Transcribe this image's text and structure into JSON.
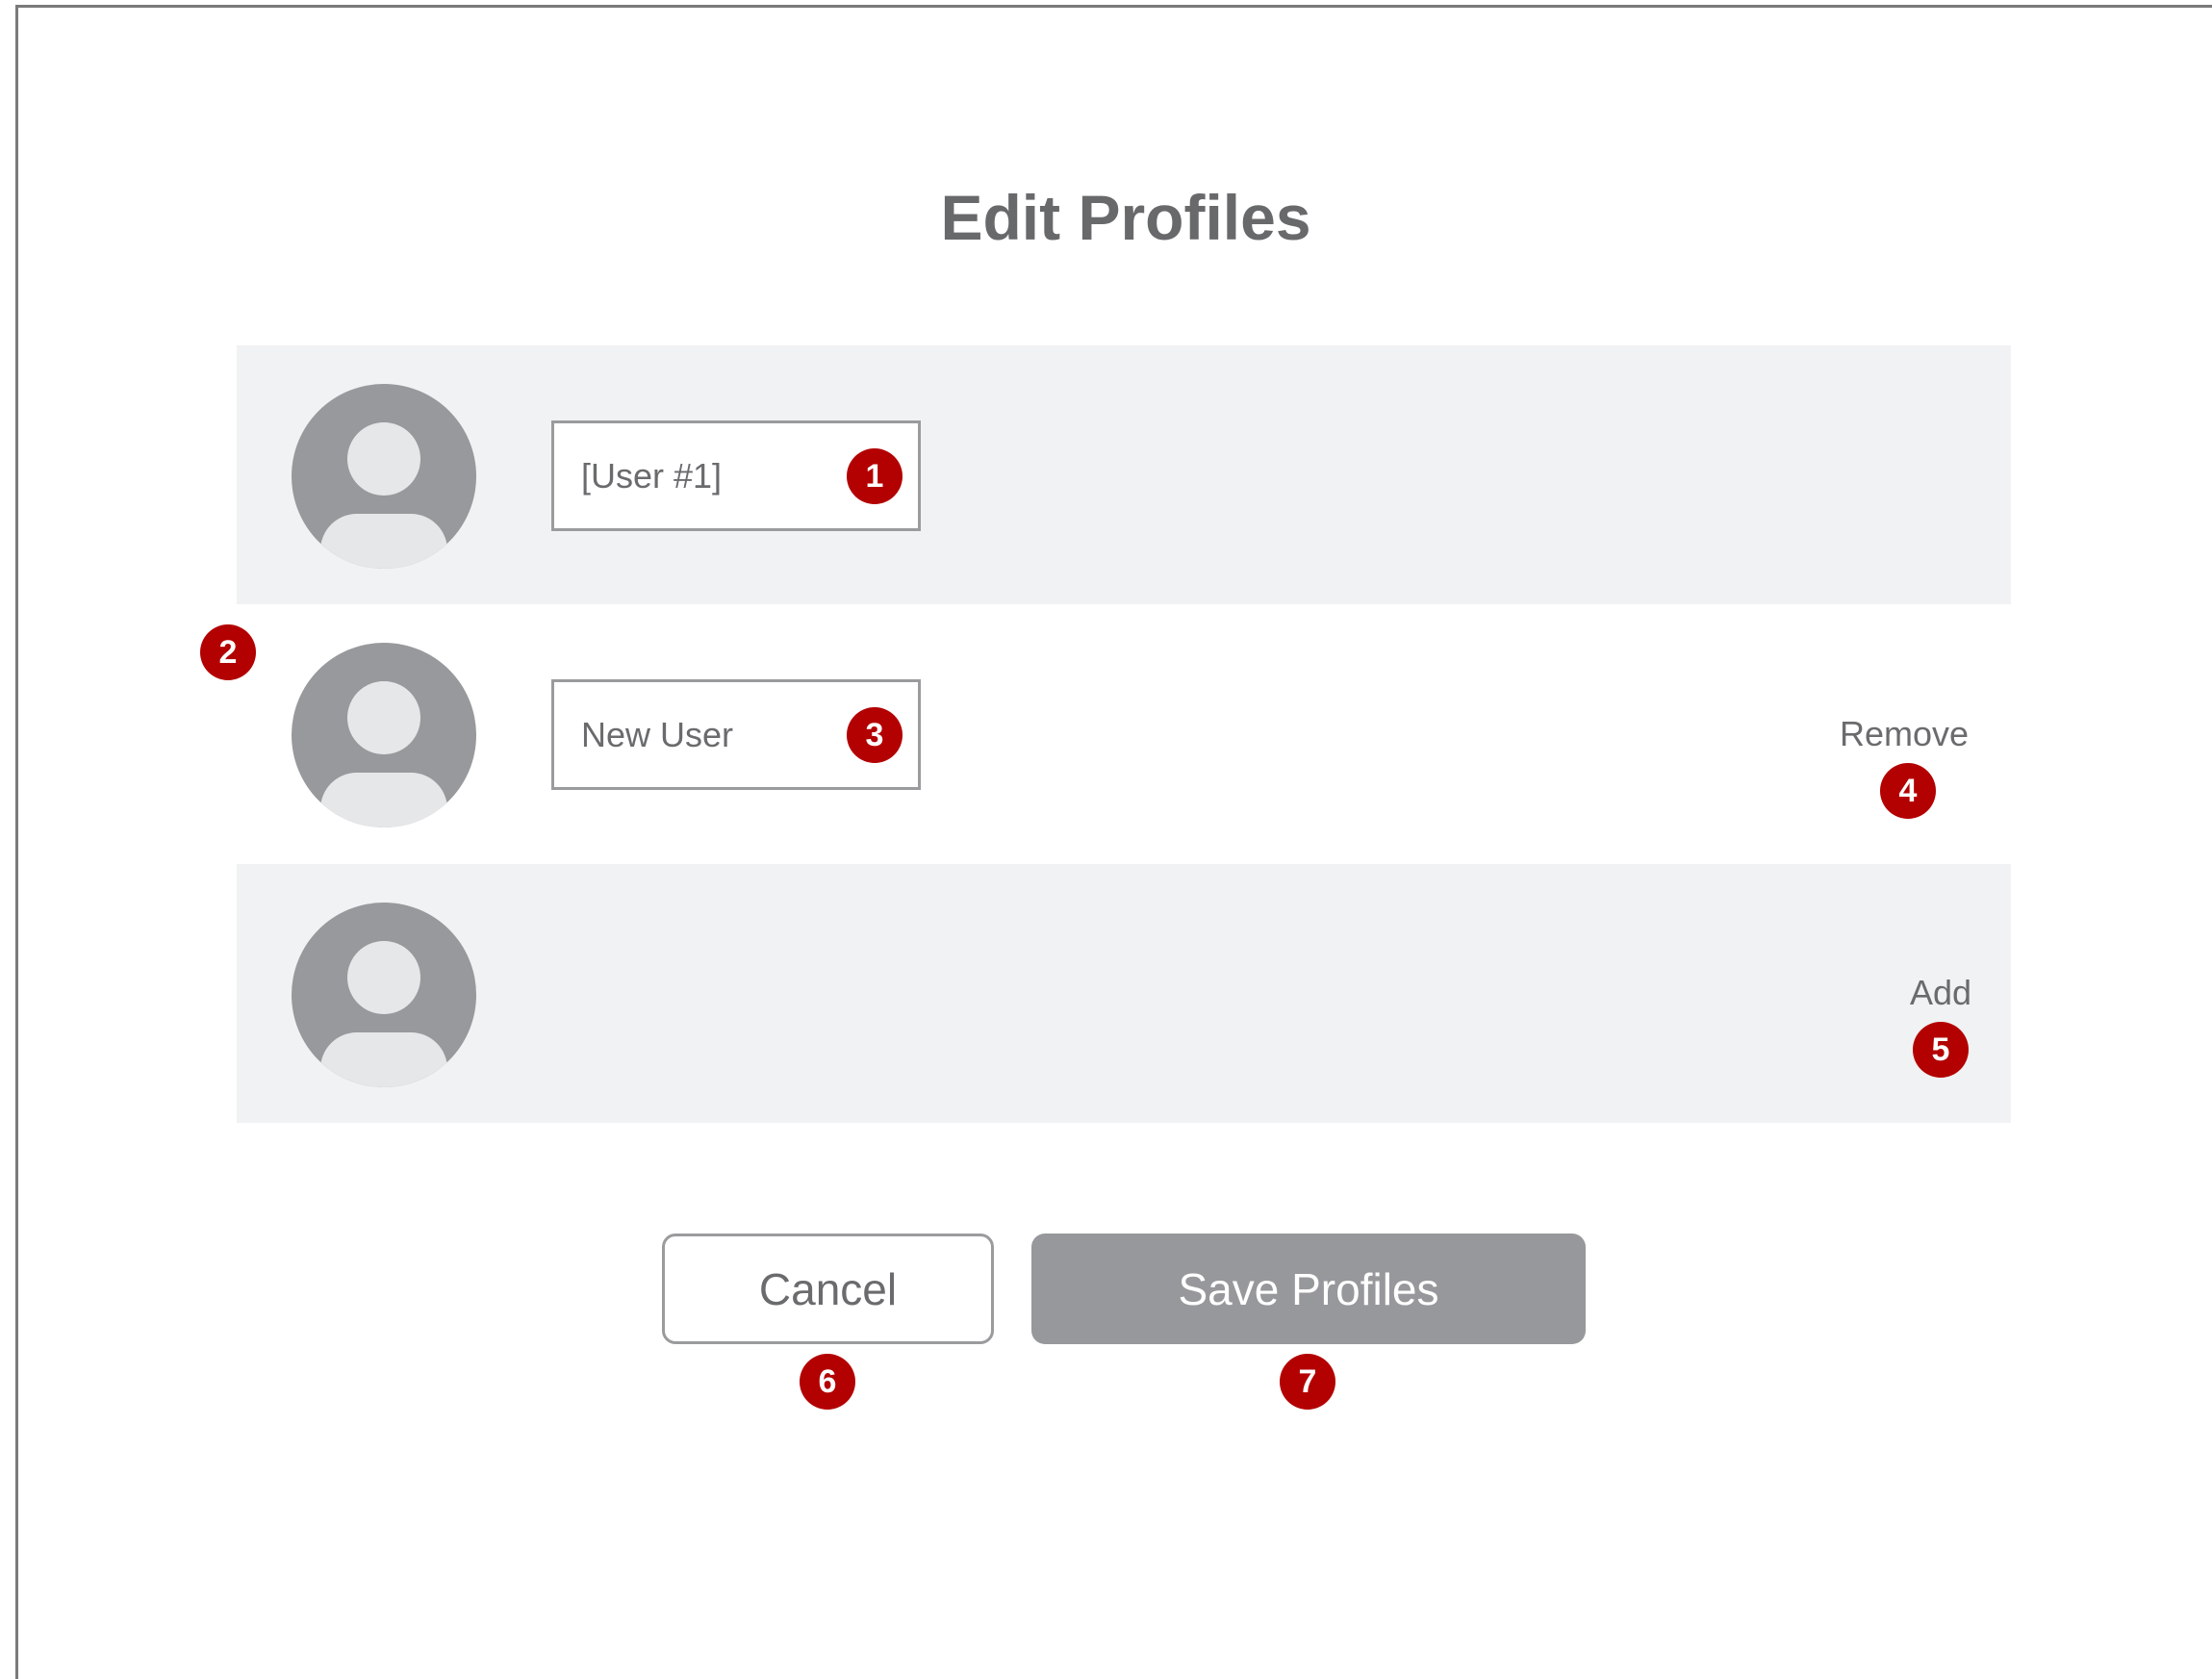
{
  "page": {
    "title": "Edit Profiles"
  },
  "profiles": [
    {
      "name_value": "[User #1]",
      "badge": "1"
    },
    {
      "name_value": "New User",
      "badge": "3",
      "row_badge": "2",
      "remove_label": "Remove",
      "remove_badge": "4"
    },
    {
      "add_label": "Add",
      "add_badge": "5"
    }
  ],
  "actions": {
    "cancel_label": "Cancel",
    "cancel_badge": "6",
    "save_label": "Save Profiles",
    "save_badge": "7"
  },
  "colors": {
    "badge": "#b30000",
    "row_shade": "#f1f2f3",
    "avatar": "#98999c",
    "save_button": "#97989b",
    "text": "#6a6b6d"
  },
  "icons": {
    "avatar": "user-avatar-icon"
  }
}
